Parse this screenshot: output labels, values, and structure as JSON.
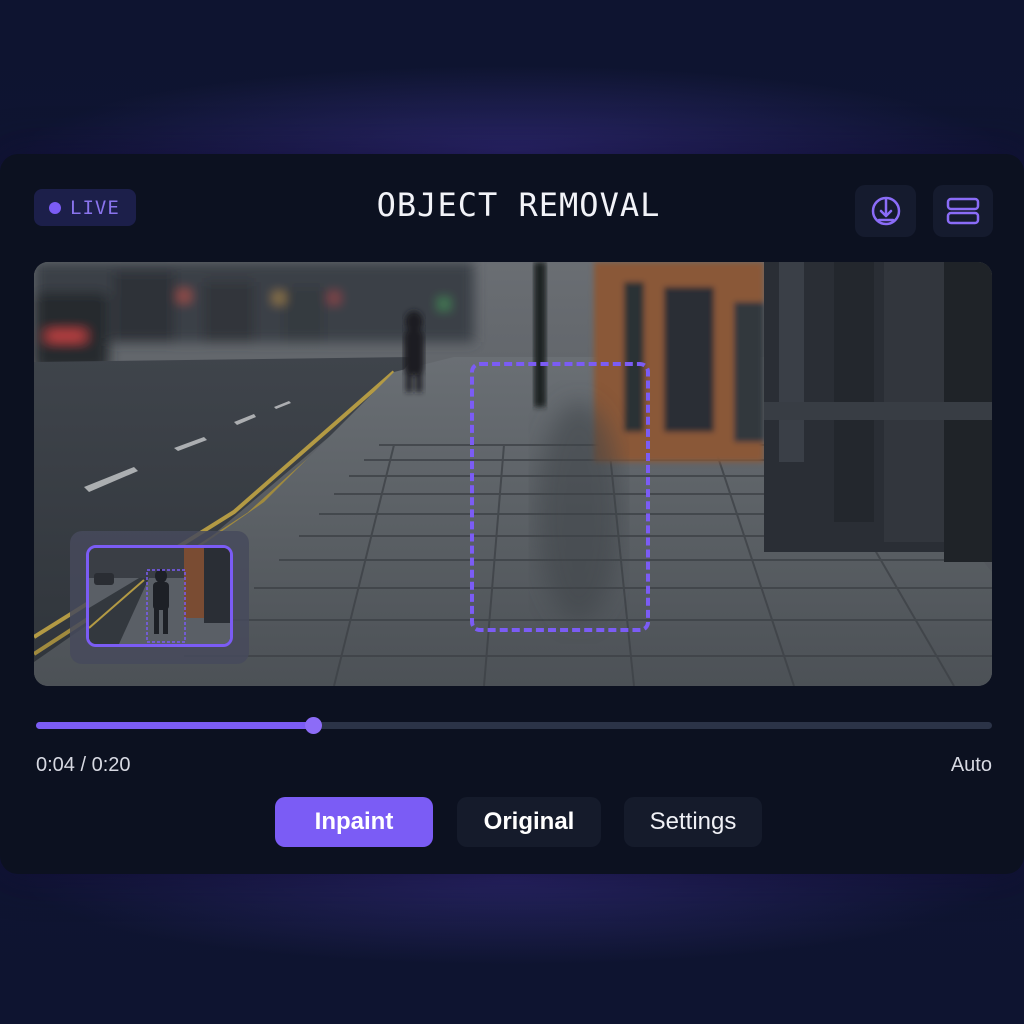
{
  "header": {
    "live_label": "LIVE",
    "title": "OBJECT REMOVAL",
    "icons": [
      "brush-target-icon",
      "layers-icon"
    ]
  },
  "player": {
    "progress": 0.29,
    "current_time": "0:04",
    "duration": "0:20",
    "time_display": "0:04 / 0:20",
    "quality": "Auto"
  },
  "actions": {
    "inpaint_label": "Inpaint",
    "original_label": "Original",
    "settings_label": "Settings"
  },
  "colors": {
    "accent": "#7b5cf5",
    "panel": "#0c1120",
    "button_dark": "#151b2b"
  }
}
